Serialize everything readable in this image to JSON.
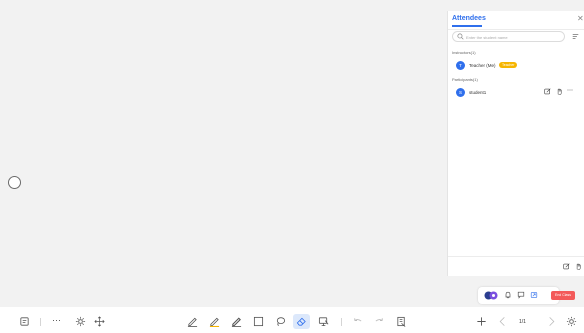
{
  "attendees_panel": {
    "title": "Attendees",
    "close_icon": "close-icon",
    "search": {
      "placeholder": "Enter the student name",
      "value": ""
    },
    "sort_icon": "sort-icon",
    "instructors_label": "Instructors(1)",
    "participants_label": "Participants(1)",
    "instructors": [
      {
        "avatar_initial": "T",
        "name": "Teacher (Me)",
        "role": "Teacher"
      }
    ],
    "participants": [
      {
        "avatar_initial": "S",
        "name": "student1",
        "actions": [
          "edit-icon",
          "raise-hand-icon",
          "more-icon"
        ]
      }
    ]
  },
  "class_controls": {
    "end_class_label": "End Class",
    "end_class_color": "#f35a5a",
    "icons": [
      "participants-avatars-icon",
      "bell-icon",
      "chat-icon",
      "share-icon"
    ]
  },
  "toolbar": {
    "page_indicator": "1/1",
    "active_tool": "eraser",
    "accent_color": "#2f6fec",
    "highlight_color": "#f6b500"
  }
}
